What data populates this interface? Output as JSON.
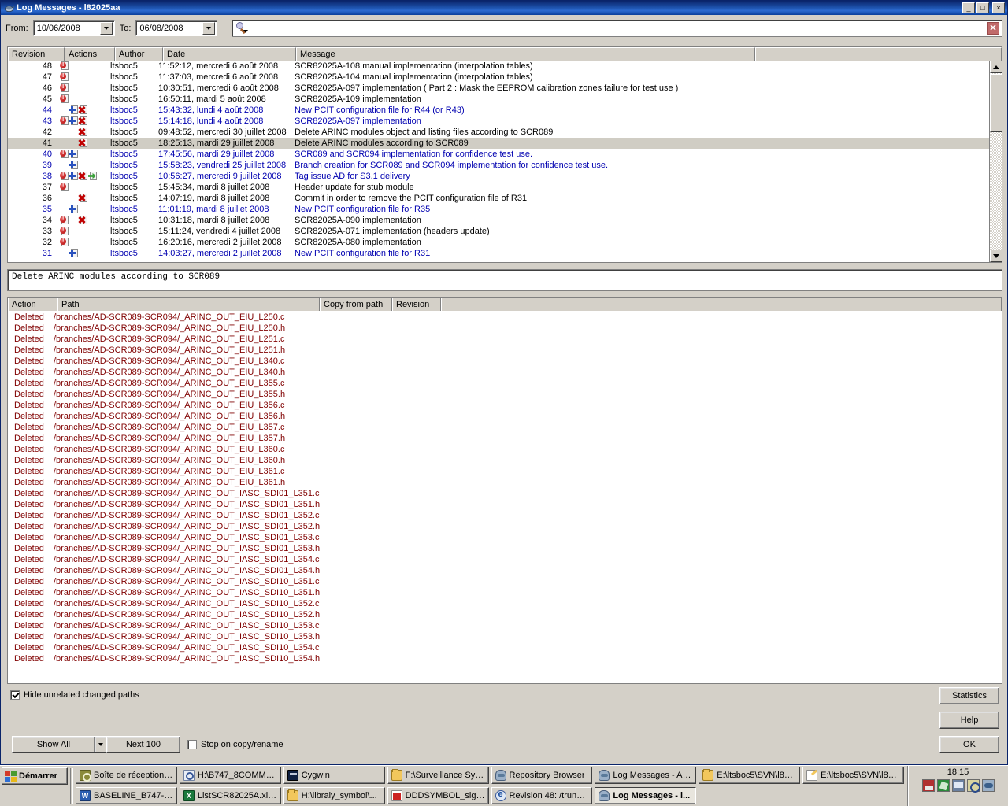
{
  "window": {
    "title": "Log Messages - l82025aa",
    "icon": "tortoisesvn-icon",
    "minimize_label": "_",
    "maximize_label": "□",
    "close_label": "×"
  },
  "filter": {
    "from_label": "From:",
    "from_value": "10/06/2008",
    "to_label": "To:",
    "to_value": "06/08/2008",
    "search_value": "",
    "search_placeholder": ""
  },
  "log_table": {
    "columns": [
      "Revision",
      "Actions",
      "Author",
      "Date",
      "Message"
    ],
    "selected_revision": "41",
    "rows": [
      {
        "revision": "48",
        "actions": [
          "mod"
        ],
        "author": "ltsboc5",
        "date": "11:52:12, mercredi 6 août 2008",
        "message": "SCR82025A-108 manual implementation (interpolation tables)",
        "blue": false
      },
      {
        "revision": "47",
        "actions": [
          "mod"
        ],
        "author": "ltsboc5",
        "date": "11:37:03, mercredi 6 août 2008",
        "message": "SCR82025A-104 manual implementation (interpolation tables)",
        "blue": false
      },
      {
        "revision": "46",
        "actions": [
          "mod"
        ],
        "author": "ltsboc5",
        "date": "10:30:51, mercredi 6 août 2008",
        "message": "SCR82025A-097 implementation ( Part 2 : Mask the EEPROM calibration zones failure for test use )",
        "blue": false
      },
      {
        "revision": "45",
        "actions": [
          "mod"
        ],
        "author": "ltsboc5",
        "date": "16:50:11, mardi 5 août 2008",
        "message": "SCR82025A-109 implementation",
        "blue": false
      },
      {
        "revision": "44",
        "actions": [
          "blank",
          "add",
          "del"
        ],
        "author": "ltsboc5",
        "date": "15:43:32, lundi 4 août 2008",
        "message": "New PCIT configuration file for R44 (or R43)",
        "blue": true
      },
      {
        "revision": "43",
        "actions": [
          "mod",
          "add",
          "del"
        ],
        "author": "ltsboc5",
        "date": "15:14:18, lundi 4 août 2008",
        "message": "SCR82025A-097 implementation",
        "blue": true
      },
      {
        "revision": "42",
        "actions": [
          "blank",
          "blank",
          "del"
        ],
        "author": "ltsboc5",
        "date": "09:48:52, mercredi 30 juillet 2008",
        "message": "Delete ARINC modules object and listing files according to SCR089",
        "blue": false
      },
      {
        "revision": "41",
        "actions": [
          "blank",
          "blank",
          "del"
        ],
        "author": "ltsboc5",
        "date": "18:25:13, mardi 29 juillet 2008",
        "message": "Delete ARINC modules according to SCR089",
        "blue": false
      },
      {
        "revision": "40",
        "actions": [
          "mod",
          "add"
        ],
        "author": "ltsboc5",
        "date": "17:45:56, mardi 29 juillet 2008",
        "message": "SCR089 and SCR094 implementation for confidence test use.",
        "blue": true
      },
      {
        "revision": "39",
        "actions": [
          "blank",
          "add"
        ],
        "author": "ltsboc5",
        "date": "15:58:23, vendredi 25 juillet 2008",
        "message": "Branch creation for SCR089 and SCR094 implementation for confidence test use.",
        "blue": true
      },
      {
        "revision": "38",
        "actions": [
          "mod",
          "add",
          "del",
          "mov"
        ],
        "author": "ltsboc5",
        "date": "10:56:27, mercredi 9 juillet 2008",
        "message": "Tag issue AD for S3.1 delivery",
        "blue": true
      },
      {
        "revision": "37",
        "actions": [
          "mod"
        ],
        "author": "ltsboc5",
        "date": "15:45:34, mardi 8 juillet 2008",
        "message": "Header update for stub module",
        "blue": false
      },
      {
        "revision": "36",
        "actions": [
          "blank",
          "blank",
          "del"
        ],
        "author": "ltsboc5",
        "date": "14:07:19, mardi 8 juillet 2008",
        "message": "Commit in order to remove the PCIT configuration file of R31",
        "blue": false
      },
      {
        "revision": "35",
        "actions": [
          "blank",
          "add"
        ],
        "author": "ltsboc5",
        "date": "11:01:19, mardi 8 juillet 2008",
        "message": "New PCIT configuration file for R35",
        "blue": true
      },
      {
        "revision": "34",
        "actions": [
          "mod",
          "blank",
          "del"
        ],
        "author": "ltsboc5",
        "date": "10:31:18, mardi 8 juillet 2008",
        "message": "SCR82025A-090 implementation",
        "blue": false
      },
      {
        "revision": "33",
        "actions": [
          "mod"
        ],
        "author": "ltsboc5",
        "date": "15:11:24, vendredi 4 juillet 2008",
        "message": "SCR82025A-071 implementation (headers update)",
        "blue": false
      },
      {
        "revision": "32",
        "actions": [
          "mod"
        ],
        "author": "ltsboc5",
        "date": "16:20:16, mercredi 2 juillet 2008",
        "message": "SCR82025A-080 implementation",
        "blue": false
      },
      {
        "revision": "31",
        "actions": [
          "blank",
          "add"
        ],
        "author": "ltsboc5",
        "date": "14:03:27, mercredi 2 juillet 2008",
        "message": "New PCIT configuration file for R31",
        "blue": true
      }
    ]
  },
  "commit_message": "Delete ARINC modules according to SCR089",
  "paths_table": {
    "columns": [
      "Action",
      "Path",
      "Copy from path",
      "Revision"
    ],
    "rows": [
      {
        "action": "Deleted",
        "path": "/branches/AD-SCR089-SCR094/_ARINC_OUT_EIU_L250.c",
        "copy_from": "",
        "revision": ""
      },
      {
        "action": "Deleted",
        "path": "/branches/AD-SCR089-SCR094/_ARINC_OUT_EIU_L250.h",
        "copy_from": "",
        "revision": ""
      },
      {
        "action": "Deleted",
        "path": "/branches/AD-SCR089-SCR094/_ARINC_OUT_EIU_L251.c",
        "copy_from": "",
        "revision": ""
      },
      {
        "action": "Deleted",
        "path": "/branches/AD-SCR089-SCR094/_ARINC_OUT_EIU_L251.h",
        "copy_from": "",
        "revision": ""
      },
      {
        "action": "Deleted",
        "path": "/branches/AD-SCR089-SCR094/_ARINC_OUT_EIU_L340.c",
        "copy_from": "",
        "revision": ""
      },
      {
        "action": "Deleted",
        "path": "/branches/AD-SCR089-SCR094/_ARINC_OUT_EIU_L340.h",
        "copy_from": "",
        "revision": ""
      },
      {
        "action": "Deleted",
        "path": "/branches/AD-SCR089-SCR094/_ARINC_OUT_EIU_L355.c",
        "copy_from": "",
        "revision": ""
      },
      {
        "action": "Deleted",
        "path": "/branches/AD-SCR089-SCR094/_ARINC_OUT_EIU_L355.h",
        "copy_from": "",
        "revision": ""
      },
      {
        "action": "Deleted",
        "path": "/branches/AD-SCR089-SCR094/_ARINC_OUT_EIU_L356.c",
        "copy_from": "",
        "revision": ""
      },
      {
        "action": "Deleted",
        "path": "/branches/AD-SCR089-SCR094/_ARINC_OUT_EIU_L356.h",
        "copy_from": "",
        "revision": ""
      },
      {
        "action": "Deleted",
        "path": "/branches/AD-SCR089-SCR094/_ARINC_OUT_EIU_L357.c",
        "copy_from": "",
        "revision": ""
      },
      {
        "action": "Deleted",
        "path": "/branches/AD-SCR089-SCR094/_ARINC_OUT_EIU_L357.h",
        "copy_from": "",
        "revision": ""
      },
      {
        "action": "Deleted",
        "path": "/branches/AD-SCR089-SCR094/_ARINC_OUT_EIU_L360.c",
        "copy_from": "",
        "revision": ""
      },
      {
        "action": "Deleted",
        "path": "/branches/AD-SCR089-SCR094/_ARINC_OUT_EIU_L360.h",
        "copy_from": "",
        "revision": ""
      },
      {
        "action": "Deleted",
        "path": "/branches/AD-SCR089-SCR094/_ARINC_OUT_EIU_L361.c",
        "copy_from": "",
        "revision": ""
      },
      {
        "action": "Deleted",
        "path": "/branches/AD-SCR089-SCR094/_ARINC_OUT_EIU_L361.h",
        "copy_from": "",
        "revision": ""
      },
      {
        "action": "Deleted",
        "path": "/branches/AD-SCR089-SCR094/_ARINC_OUT_IASC_SDI01_L351.c",
        "copy_from": "",
        "revision": ""
      },
      {
        "action": "Deleted",
        "path": "/branches/AD-SCR089-SCR094/_ARINC_OUT_IASC_SDI01_L351.h",
        "copy_from": "",
        "revision": ""
      },
      {
        "action": "Deleted",
        "path": "/branches/AD-SCR089-SCR094/_ARINC_OUT_IASC_SDI01_L352.c",
        "copy_from": "",
        "revision": ""
      },
      {
        "action": "Deleted",
        "path": "/branches/AD-SCR089-SCR094/_ARINC_OUT_IASC_SDI01_L352.h",
        "copy_from": "",
        "revision": ""
      },
      {
        "action": "Deleted",
        "path": "/branches/AD-SCR089-SCR094/_ARINC_OUT_IASC_SDI01_L353.c",
        "copy_from": "",
        "revision": ""
      },
      {
        "action": "Deleted",
        "path": "/branches/AD-SCR089-SCR094/_ARINC_OUT_IASC_SDI01_L353.h",
        "copy_from": "",
        "revision": ""
      },
      {
        "action": "Deleted",
        "path": "/branches/AD-SCR089-SCR094/_ARINC_OUT_IASC_SDI01_L354.c",
        "copy_from": "",
        "revision": ""
      },
      {
        "action": "Deleted",
        "path": "/branches/AD-SCR089-SCR094/_ARINC_OUT_IASC_SDI01_L354.h",
        "copy_from": "",
        "revision": ""
      },
      {
        "action": "Deleted",
        "path": "/branches/AD-SCR089-SCR094/_ARINC_OUT_IASC_SDI10_L351.c",
        "copy_from": "",
        "revision": ""
      },
      {
        "action": "Deleted",
        "path": "/branches/AD-SCR089-SCR094/_ARINC_OUT_IASC_SDI10_L351.h",
        "copy_from": "",
        "revision": ""
      },
      {
        "action": "Deleted",
        "path": "/branches/AD-SCR089-SCR094/_ARINC_OUT_IASC_SDI10_L352.c",
        "copy_from": "",
        "revision": ""
      },
      {
        "action": "Deleted",
        "path": "/branches/AD-SCR089-SCR094/_ARINC_OUT_IASC_SDI10_L352.h",
        "copy_from": "",
        "revision": ""
      },
      {
        "action": "Deleted",
        "path": "/branches/AD-SCR089-SCR094/_ARINC_OUT_IASC_SDI10_L353.c",
        "copy_from": "",
        "revision": ""
      },
      {
        "action": "Deleted",
        "path": "/branches/AD-SCR089-SCR094/_ARINC_OUT_IASC_SDI10_L353.h",
        "copy_from": "",
        "revision": ""
      },
      {
        "action": "Deleted",
        "path": "/branches/AD-SCR089-SCR094/_ARINC_OUT_IASC_SDI10_L354.c",
        "copy_from": "",
        "revision": ""
      },
      {
        "action": "Deleted",
        "path": "/branches/AD-SCR089-SCR094/_ARINC_OUT_IASC_SDI10_L354.h",
        "copy_from": "",
        "revision": ""
      }
    ]
  },
  "footer": {
    "hide_unrelated_label": "Hide unrelated changed paths",
    "hide_unrelated_checked": true,
    "show_all_label": "Show All",
    "next_100_label": "Next 100",
    "stop_on_copy_label": "Stop on copy/rename",
    "stop_on_copy_checked": false,
    "statistics_label": "Statistics",
    "help_label": "Help",
    "ok_label": "OK"
  },
  "taskbar": {
    "start_label": "Démarrer",
    "time": "18:15",
    "buttons_row1": [
      {
        "label": "Boîte de réception -...",
        "icon": "outlook",
        "active": false
      },
      {
        "label": "H:\\B747_8COMMU...",
        "icon": "explorer-search",
        "active": false
      },
      {
        "label": "Cygwin",
        "icon": "cygwin",
        "active": false
      },
      {
        "label": "F:\\Surveillance Syst...",
        "icon": "folder",
        "active": false
      },
      {
        "label": "Repository Browser",
        "icon": "tortoise",
        "active": false
      },
      {
        "label": "Log Messages - AD-...",
        "icon": "tortoise",
        "active": false
      },
      {
        "label": "E:\\ltsboc5\\SVN\\l820...",
        "icon": "folder",
        "active": false
      },
      {
        "label": "E:\\ltsboc5\\SVN\\l820...",
        "icon": "notepad",
        "active": false
      }
    ],
    "buttons_row2": [
      {
        "label": "BASELINE_B747-8_...",
        "icon": "word",
        "active": false
      },
      {
        "label": "ListSCR82025A.xls ...",
        "icon": "excel",
        "active": false
      },
      {
        "label": "H:\\libraiy_symbol\\...",
        "icon": "folder",
        "active": false
      },
      {
        "label": "DDDSYMBOL_signe...",
        "icon": "pdf",
        "active": false
      },
      {
        "label": "Revision 48: /trunk ...",
        "icon": "ie",
        "active": false
      },
      {
        "label": "Log Messages - l...",
        "icon": "tortoise",
        "active": true
      }
    ],
    "tray_icons": [
      "network-icon",
      "shield-icon",
      "display-icon",
      "clock-icon",
      "tortoise-icon"
    ]
  }
}
